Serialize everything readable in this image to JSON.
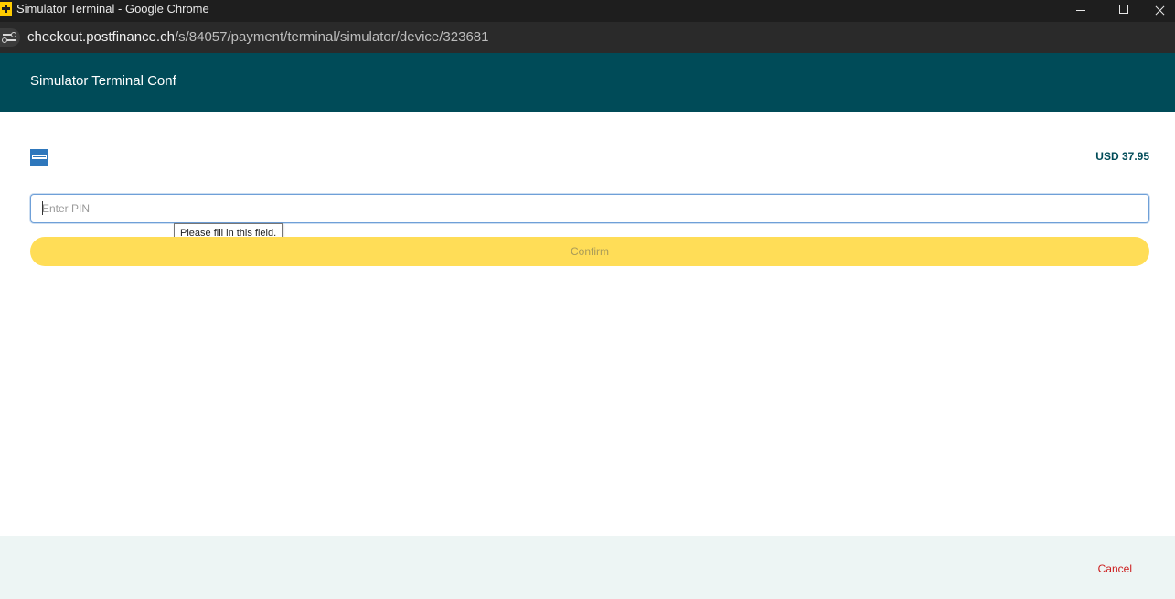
{
  "browser": {
    "window_title": "Simulator Terminal - Google Chrome",
    "url_host": "checkout.postfinance.ch",
    "url_path": "/s/84057/payment/terminal/simulator/device/323681",
    "app_icon": "postfinance-icon",
    "site_info_icon": "tune-icon"
  },
  "header": {
    "title": "Simulator Terminal Conf",
    "background": "#004b58"
  },
  "payment": {
    "card_brand_icon": "amex-card-icon",
    "amount": "USD 37.95"
  },
  "pin_field": {
    "value": "",
    "placeholder": "Enter PIN",
    "validation_tooltip": "Please fill in this field."
  },
  "actions": {
    "confirm_label": "Confirm",
    "confirm_color": "#ffdd57",
    "cancel_label": "Cancel",
    "cancel_color": "#cc1d1d"
  },
  "footer": {
    "background": "#edf5f4"
  }
}
